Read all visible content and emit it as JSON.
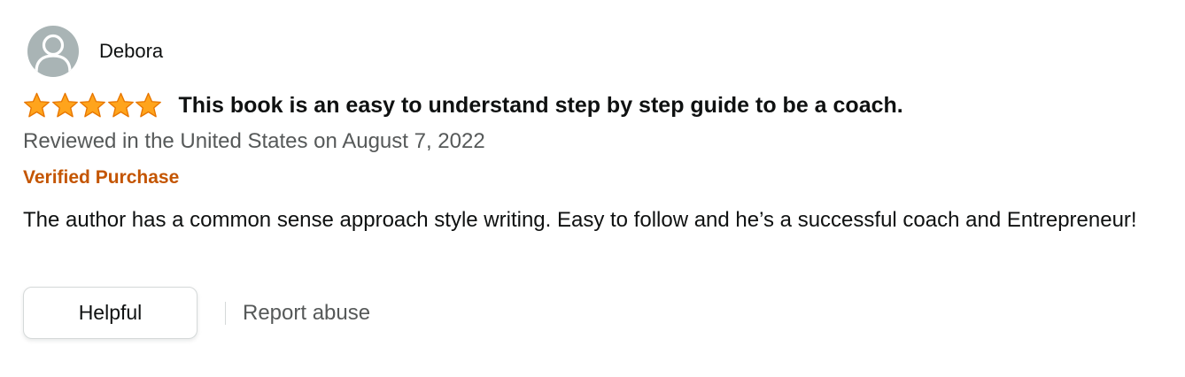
{
  "review": {
    "reviewer_name": "Debora",
    "avatar_icon": "user-silhouette-icon",
    "rating": 5,
    "rating_max": 5,
    "star_color": "#ffa41c",
    "title": "This book is an easy to understand step by step guide to be a coach.",
    "date_text": "Reviewed in the United States on August 7, 2022",
    "verified_label": "Verified Purchase",
    "verified_color": "#c45500",
    "body": "The author has a common sense approach style writing. Easy to follow and he’s a successful coach and Entrepreneur!"
  },
  "actions": {
    "helpful_label": "Helpful",
    "report_label": "Report abuse"
  }
}
